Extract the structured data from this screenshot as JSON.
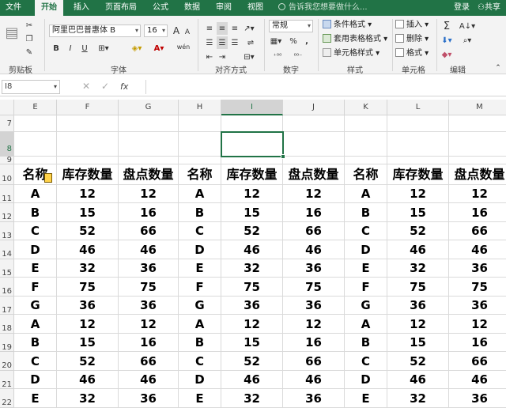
{
  "tabs": [
    "文件",
    "开始",
    "插入",
    "页面布局",
    "公式",
    "数据",
    "审阅",
    "视图"
  ],
  "tell_me": "告诉我您想要做什么...",
  "account": {
    "login": "登录",
    "share": "共享"
  },
  "ribbon": {
    "clipboard": {
      "label": "剪贴板"
    },
    "font": {
      "label": "字体",
      "name": "阿里巴巴普惠体 B",
      "size": "16",
      "bold": "B",
      "italic": "I",
      "underline": "U",
      "grow": "A",
      "shrink": "A",
      "wen": "wén"
    },
    "alignment": {
      "label": "对齐方式"
    },
    "number": {
      "label": "数字",
      "format": "常规",
      "percent": "%",
      "comma": ","
    },
    "styles": {
      "label": "样式",
      "items": [
        "条件格式",
        "套用表格格式",
        "单元格样式"
      ]
    },
    "cells": {
      "label": "单元格",
      "items": [
        "插入",
        "删除",
        "格式"
      ]
    },
    "editing": {
      "label": "编辑"
    }
  },
  "formula_bar": {
    "name_box": "I8",
    "fx": "fx",
    "content": ""
  },
  "columns": [
    "E",
    "F",
    "G",
    "H",
    "I",
    "J",
    "K",
    "L",
    "M"
  ],
  "rows": [
    "7",
    "8",
    "9",
    "10",
    "11",
    "12",
    "13",
    "14",
    "15",
    "16",
    "17",
    "18",
    "19",
    "20",
    "21",
    "22"
  ],
  "table": {
    "headers": [
      "名称",
      "库存数量",
      "盘点数量",
      "名称",
      "库存数量",
      "盘点数量",
      "名称",
      "库存数量",
      "盘点数量"
    ],
    "data": [
      [
        "A",
        "12",
        "12",
        "A",
        "12",
        "12",
        "A",
        "12",
        "12"
      ],
      [
        "B",
        "15",
        "16",
        "B",
        "15",
        "16",
        "B",
        "15",
        "16"
      ],
      [
        "C",
        "52",
        "66",
        "C",
        "52",
        "66",
        "C",
        "52",
        "66"
      ],
      [
        "D",
        "46",
        "46",
        "D",
        "46",
        "46",
        "D",
        "46",
        "46"
      ],
      [
        "E",
        "32",
        "36",
        "E",
        "32",
        "36",
        "E",
        "32",
        "36"
      ],
      [
        "F",
        "75",
        "75",
        "F",
        "75",
        "75",
        "F",
        "75",
        "75"
      ],
      [
        "G",
        "36",
        "36",
        "G",
        "36",
        "36",
        "G",
        "36",
        "36"
      ],
      [
        "A",
        "12",
        "12",
        "A",
        "12",
        "12",
        "A",
        "12",
        "12"
      ],
      [
        "B",
        "15",
        "16",
        "B",
        "15",
        "16",
        "B",
        "15",
        "16"
      ],
      [
        "C",
        "52",
        "66",
        "C",
        "52",
        "66",
        "C",
        "52",
        "66"
      ],
      [
        "D",
        "46",
        "46",
        "D",
        "46",
        "46",
        "D",
        "46",
        "46"
      ],
      [
        "E",
        "32",
        "36",
        "E",
        "32",
        "36",
        "E",
        "32",
        "36"
      ]
    ]
  },
  "colors": {
    "accent": "#217346",
    "ribbon_bg": "#f3f3f3",
    "header_bg": "#f3f3f3"
  }
}
